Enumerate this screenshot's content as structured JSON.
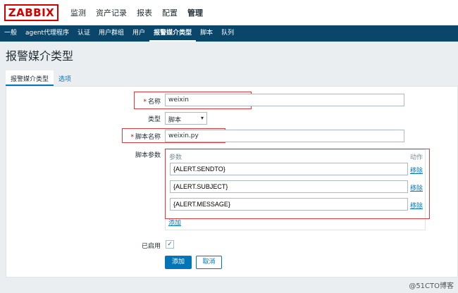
{
  "logo": "ZABBIX",
  "main_menu": [
    "监测",
    "资产记录",
    "报表",
    "配置",
    "管理"
  ],
  "sub_menu": [
    "一般",
    "agent代理程序",
    "认证",
    "用户群组",
    "用户",
    "报警媒介类型",
    "脚本",
    "队列"
  ],
  "page_title": "报警媒介类型",
  "tabs": [
    "报警媒介类型",
    "选项"
  ],
  "form": {
    "name_label": "名称",
    "name_value": "weixin",
    "type_label": "类型",
    "type_value": "脚本",
    "script_name_label": "脚本名称",
    "script_name_value": "weixin.py",
    "script_params_label": "脚本参数",
    "params_header": "参数",
    "action_header": "动作",
    "params": [
      "{ALERT.SENDTO}",
      "{ALERT.SUBJECT}",
      "{ALERT.MESSAGE}"
    ],
    "remove_label": "移除",
    "add_param_label": "添加",
    "enabled_label": "已启用",
    "enabled": true,
    "checkmark": "✓",
    "required_mark": "*",
    "caret": "▾",
    "add_button": "添加",
    "cancel_button": "取消"
  },
  "watermark": "@51CTO博客",
  "colors": {
    "header_bg": "#0a466a",
    "link": "#0275b8",
    "logo": "#d40000",
    "highlight_box": "#e0393e"
  }
}
